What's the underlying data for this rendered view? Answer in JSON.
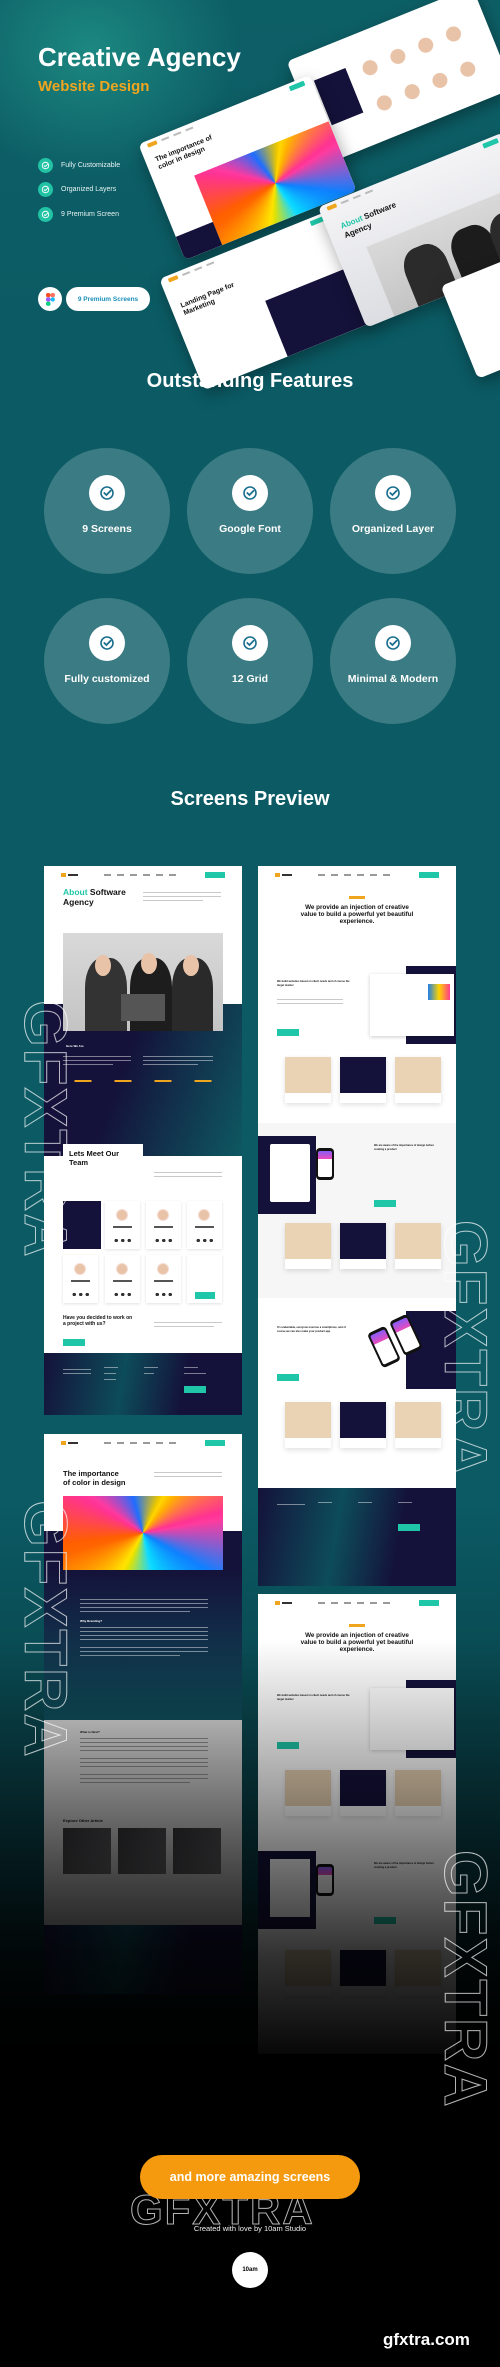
{
  "hero": {
    "title": "Creative Agency",
    "subtitle": "Website Design",
    "checklist": [
      "Fully Customizable",
      "Organized Layers",
      "9 Premium Screen"
    ],
    "badge_pill": "9 Premium Screens",
    "badge_icon": "figma-icon",
    "mockups": {
      "color_title": "The importance of color in design",
      "landing_title": "Landing Page for Marketing",
      "about_title_accent": "About",
      "about_title_rest": "Software Agency"
    }
  },
  "features": {
    "title": "Outstanding Features",
    "items": [
      {
        "label": "9 Screens",
        "icon": "check-circle-icon"
      },
      {
        "label": "Google Font",
        "icon": "check-circle-icon"
      },
      {
        "label": "Organized Layer",
        "icon": "check-circle-icon"
      },
      {
        "label": "Fully customized",
        "icon": "check-circle-icon"
      },
      {
        "label": "12 Grid",
        "icon": "check-circle-icon"
      },
      {
        "label": "Minimal & Modern",
        "icon": "check-circle-icon"
      }
    ]
  },
  "preview": {
    "title": "Screens Preview",
    "about_screen": {
      "title_accent": "About",
      "title_rest_1": "Software",
      "title_rest_2": "Agency",
      "who_we_are": "Here We Are",
      "team_title_1": "Lets Meet Our",
      "team_title_2": "Team",
      "cta_title_1": "Have you decided to work on",
      "cta_title_2": "a project with us?"
    },
    "services_screen": {
      "headline_1": "We provide an injection of creative",
      "headline_2": "value to build a powerful yet beautiful",
      "headline_3": "experience.",
      "block1": "We build websites based on client needs and of course the target market",
      "block2": "We are aware of the importance of design before creating a product",
      "block3": "It's undeniable, everyone now has a smartphone, and of course we can also make your product app"
    },
    "blog_screen": {
      "title_1": "The importance",
      "title_2": "of color in design",
      "section1": "Why Branding?",
      "section2": "What is Next?",
      "explore": "Explore Other Article"
    }
  },
  "cta": {
    "button": "and more amazing screens",
    "credit": "Created with love by 10am Studio",
    "studio_logo": "10am"
  },
  "watermark": {
    "text": "GFXTRA",
    "site": "gfxtra.com"
  },
  "colors": {
    "accent_teal": "#1fc6a8",
    "accent_orange": "#f59a0e",
    "background": "#0b5a64",
    "navy": "#14123a"
  }
}
